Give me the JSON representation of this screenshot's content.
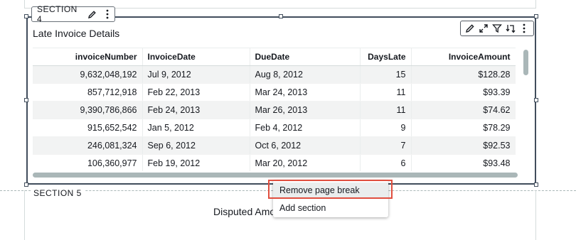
{
  "section4": {
    "label": "SECTION 4"
  },
  "visual": {
    "title": "Late Invoice Details",
    "toolbar_icons": [
      "pencil-icon",
      "expand-icon",
      "filter-icon",
      "drill-icon",
      "more-icon"
    ]
  },
  "table": {
    "columns": [
      "invoiceNumber",
      "InvoiceDate",
      "DueDate",
      "DaysLate",
      "InvoiceAmount"
    ],
    "rows": [
      [
        "9,632,048,192",
        "Jul 9, 2012",
        "Aug 8, 2012",
        "15",
        "$128.28"
      ],
      [
        "857,712,918",
        "Feb 22, 2013",
        "Mar 24, 2013",
        "11",
        "$93.39"
      ],
      [
        "9,390,786,866",
        "Feb 24, 2013",
        "Mar 26, 2013",
        "11",
        "$74.62"
      ],
      [
        "915,652,542",
        "Jan 5, 2012",
        "Feb 4, 2012",
        "9",
        "$78.29"
      ],
      [
        "246,081,324",
        "Sep 6, 2012",
        "Oct 6, 2012",
        "7",
        "$92.53"
      ],
      [
        "106,360,977",
        "Feb 19, 2012",
        "Mar 20, 2012",
        "6",
        "$93.48"
      ]
    ]
  },
  "section5": {
    "label": "SECTION 5",
    "visual_title": "Disputed Amo"
  },
  "context_menu": {
    "items": [
      {
        "label": "Remove page break",
        "highlighted": true
      },
      {
        "label": "Add section",
        "highlighted": false
      }
    ]
  },
  "colors": {
    "highlight_border": "#e04f3f",
    "selected_border": "#414d5c",
    "row_stripe": "#f2f3f3"
  }
}
